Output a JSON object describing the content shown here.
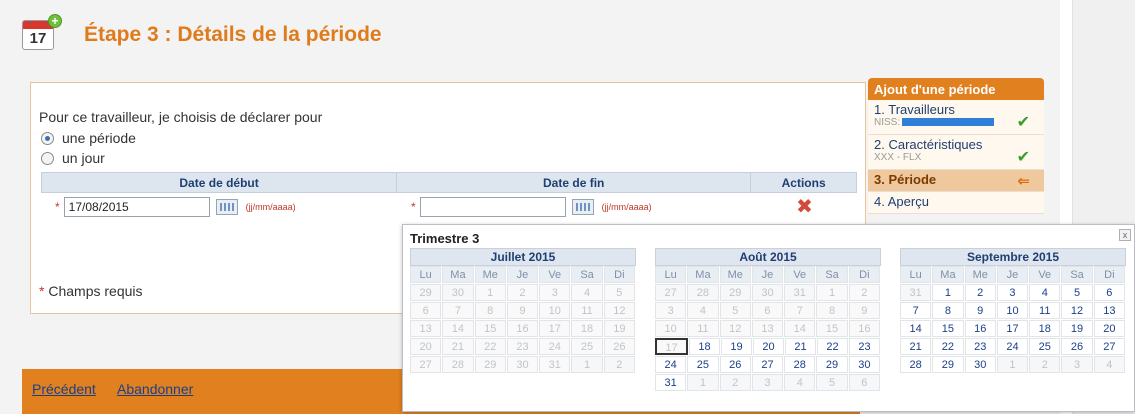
{
  "header": {
    "cal_icon_day": "17",
    "title": "Étape 3 : Détails de la période"
  },
  "form": {
    "intro": "Pour ce travailleur, je choisis de déclarer pour",
    "radios": [
      {
        "label": "une période",
        "checked": true
      },
      {
        "label": "un jour",
        "checked": false
      }
    ],
    "columns": [
      "Date de début",
      "Date de fin",
      "Actions"
    ],
    "start_required": "*",
    "start_value": "17/08/2015",
    "start_hint": "(jj/mm/aaaa)",
    "end_required": "*",
    "end_value": "",
    "end_hint": "(jj/mm/aaaa)",
    "delete_icon": "delete-x-icon",
    "required_star": "*",
    "required_note": "Champs requis"
  },
  "footer": {
    "previous": "Précédent",
    "cancel": "Abandonner"
  },
  "steps": {
    "title": "Ajout d'une période",
    "items": [
      {
        "number": "1.",
        "label": "Travailleurs",
        "sub": "NISS:",
        "done": true
      },
      {
        "number": "2.",
        "label": "Caractéristiques",
        "sub": "XXX  -  FLX",
        "done": true
      },
      {
        "number": "3.",
        "label": "Période",
        "active": true
      },
      {
        "number": "4.",
        "label": "Aperçu"
      }
    ]
  },
  "picker": {
    "title": "Trimestre  3",
    "close": "x",
    "weekdays": [
      "Lu",
      "Ma",
      "Me",
      "Je",
      "Ve",
      "Sa",
      "Di"
    ],
    "months": [
      {
        "name": "Juillet 2015",
        "weeks": [
          [
            [
              "29",
              "other"
            ],
            [
              "30",
              "other"
            ],
            [
              "1",
              "dis"
            ],
            [
              "2",
              "dis"
            ],
            [
              "3",
              "dis"
            ],
            [
              "4",
              "dis"
            ],
            [
              "5",
              "dis"
            ]
          ],
          [
            [
              "6",
              "dis"
            ],
            [
              "7",
              "dis"
            ],
            [
              "8",
              "dis"
            ],
            [
              "9",
              "dis"
            ],
            [
              "10",
              "dis"
            ],
            [
              "11",
              "dis"
            ],
            [
              "12",
              "dis"
            ]
          ],
          [
            [
              "13",
              "dis"
            ],
            [
              "14",
              "dis"
            ],
            [
              "15",
              "dis"
            ],
            [
              "16",
              "dis"
            ],
            [
              "17",
              "dis"
            ],
            [
              "18",
              "dis"
            ],
            [
              "19",
              "dis"
            ]
          ],
          [
            [
              "20",
              "dis"
            ],
            [
              "21",
              "dis"
            ],
            [
              "22",
              "dis"
            ],
            [
              "23",
              "dis"
            ],
            [
              "24",
              "dis"
            ],
            [
              "25",
              "dis"
            ],
            [
              "26",
              "dis"
            ]
          ],
          [
            [
              "27",
              "dis"
            ],
            [
              "28",
              "dis"
            ],
            [
              "29",
              "dis"
            ],
            [
              "30",
              "dis"
            ],
            [
              "31",
              "dis"
            ],
            [
              "1",
              "other"
            ],
            [
              "2",
              "other"
            ]
          ]
        ]
      },
      {
        "name": "Août 2015",
        "weeks": [
          [
            [
              "27",
              "other"
            ],
            [
              "28",
              "other"
            ],
            [
              "29",
              "other"
            ],
            [
              "30",
              "other"
            ],
            [
              "31",
              "other"
            ],
            [
              "1",
              "dis"
            ],
            [
              "2",
              "dis"
            ]
          ],
          [
            [
              "3",
              "dis"
            ],
            [
              "4",
              "dis"
            ],
            [
              "5",
              "dis"
            ],
            [
              "6",
              "dis"
            ],
            [
              "7",
              "dis"
            ],
            [
              "8",
              "dis"
            ],
            [
              "9",
              "dis"
            ]
          ],
          [
            [
              "10",
              "dis"
            ],
            [
              "11",
              "dis"
            ],
            [
              "12",
              "dis"
            ],
            [
              "13",
              "dis"
            ],
            [
              "14",
              "dis"
            ],
            [
              "15",
              "dis"
            ],
            [
              "16",
              "dis"
            ]
          ],
          [
            [
              "17",
              "dis sel"
            ],
            [
              "18",
              "in"
            ],
            [
              "19",
              "in"
            ],
            [
              "20",
              "in"
            ],
            [
              "21",
              "in"
            ],
            [
              "22",
              "in"
            ],
            [
              "23",
              "in"
            ]
          ],
          [
            [
              "24",
              "in"
            ],
            [
              "25",
              "in"
            ],
            [
              "26",
              "in"
            ],
            [
              "27",
              "in"
            ],
            [
              "28",
              "in"
            ],
            [
              "29",
              "in"
            ],
            [
              "30",
              "in"
            ]
          ],
          [
            [
              "31",
              "in"
            ],
            [
              "1",
              "other"
            ],
            [
              "2",
              "other"
            ],
            [
              "3",
              "other"
            ],
            [
              "4",
              "other"
            ],
            [
              "5",
              "other"
            ],
            [
              "6",
              "other"
            ]
          ]
        ]
      },
      {
        "name": "Septembre 2015",
        "weeks": [
          [
            [
              "31",
              "other"
            ],
            [
              "1",
              "in"
            ],
            [
              "2",
              "in"
            ],
            [
              "3",
              "in"
            ],
            [
              "4",
              "in"
            ],
            [
              "5",
              "in"
            ],
            [
              "6",
              "in"
            ]
          ],
          [
            [
              "7",
              "in"
            ],
            [
              "8",
              "in"
            ],
            [
              "9",
              "in"
            ],
            [
              "10",
              "in"
            ],
            [
              "11",
              "in"
            ],
            [
              "12",
              "in"
            ],
            [
              "13",
              "in"
            ]
          ],
          [
            [
              "14",
              "in"
            ],
            [
              "15",
              "in"
            ],
            [
              "16",
              "in"
            ],
            [
              "17",
              "in"
            ],
            [
              "18",
              "in"
            ],
            [
              "19",
              "in"
            ],
            [
              "20",
              "in"
            ]
          ],
          [
            [
              "21",
              "in"
            ],
            [
              "22",
              "in"
            ],
            [
              "23",
              "in"
            ],
            [
              "24",
              "in"
            ],
            [
              "25",
              "in"
            ],
            [
              "26",
              "in"
            ],
            [
              "27",
              "in"
            ]
          ],
          [
            [
              "28",
              "in"
            ],
            [
              "29",
              "in"
            ],
            [
              "30",
              "in"
            ],
            [
              "1",
              "other"
            ],
            [
              "2",
              "other"
            ],
            [
              "3",
              "other"
            ],
            [
              "4",
              "other"
            ]
          ]
        ]
      }
    ]
  }
}
